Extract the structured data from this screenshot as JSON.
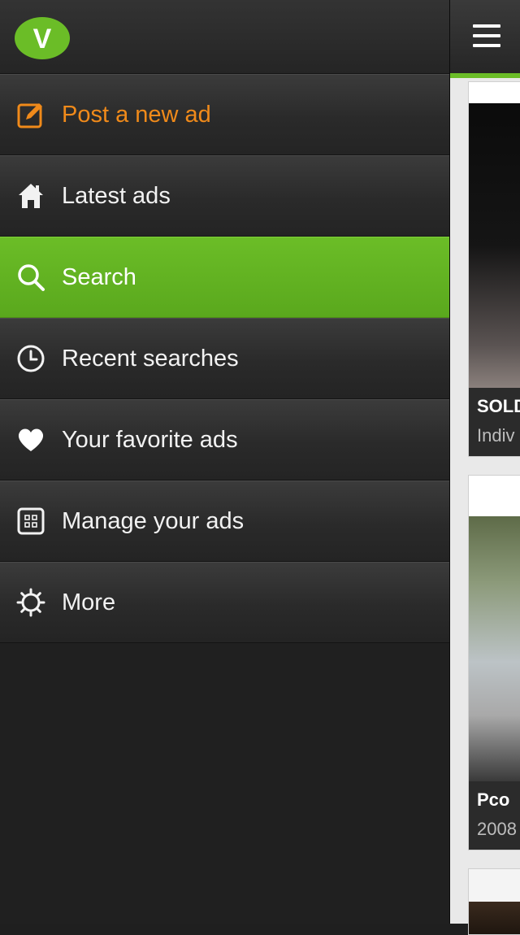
{
  "app": {
    "logo_letter": "V",
    "logo_color": "#6bbd27"
  },
  "menu": {
    "items": [
      {
        "label": "Post a new ad",
        "icon": "edit-icon"
      },
      {
        "label": "Latest ads",
        "icon": "home-icon"
      },
      {
        "label": "Search",
        "icon": "search-icon",
        "active": true
      },
      {
        "label": "Recent searches",
        "icon": "clock-icon"
      },
      {
        "label": "Your favorite ads",
        "icon": "heart-icon"
      },
      {
        "label": "Manage your ads",
        "icon": "grid-icon"
      },
      {
        "label": "More",
        "icon": "gear-icon"
      }
    ]
  },
  "content": {
    "cards": [
      {
        "title": "SOLD",
        "subtitle": "Indiv"
      },
      {
        "title": "Pco",
        "subtitle": "2008"
      }
    ]
  },
  "colors": {
    "accent": "#6bbd27",
    "post": "#f08a1a",
    "drawer_bg": "#202020"
  }
}
